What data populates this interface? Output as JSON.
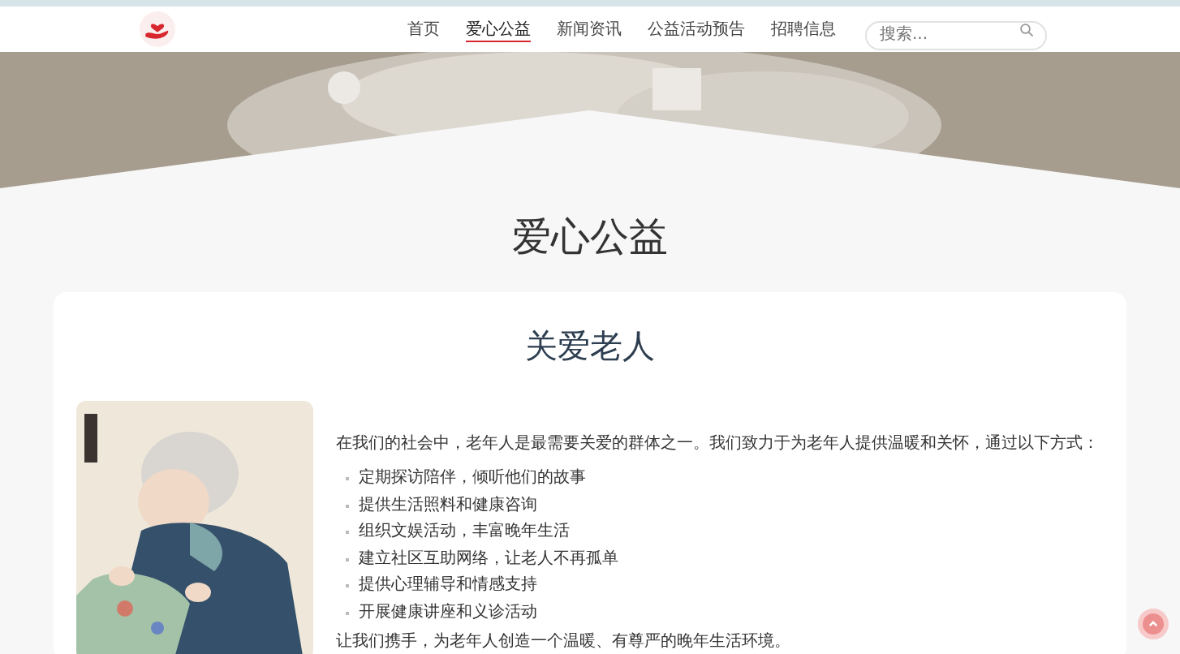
{
  "nav": {
    "items": [
      {
        "label": "首页",
        "selected": false
      },
      {
        "label": "爱心公益",
        "selected": true
      },
      {
        "label": "新闻资讯",
        "selected": false
      },
      {
        "label": "公益活动预告",
        "selected": false
      },
      {
        "label": "招聘信息",
        "selected": false
      }
    ],
    "search": {
      "placeholder": "搜索..."
    }
  },
  "page_title": "爱心公益",
  "card": {
    "title": "关爱老人",
    "intro": "在我们的社会中，老年人是最需要关爱的群体之一。我们致力于为老年人提供温暖和关怀，通过以下方式：",
    "items": [
      "定期探访陪伴，倾听他们的故事",
      "提供生活照料和健康咨询",
      "组织文娱活动，丰富晚年生活",
      "建立社区互助网络，让老人不再孤单",
      "提供心理辅导和情感支持",
      "开展健康讲座和义诊活动"
    ],
    "closing": "让我们携手，为老年人创造一个温暖、有尊严的晚年生活环境。"
  }
}
